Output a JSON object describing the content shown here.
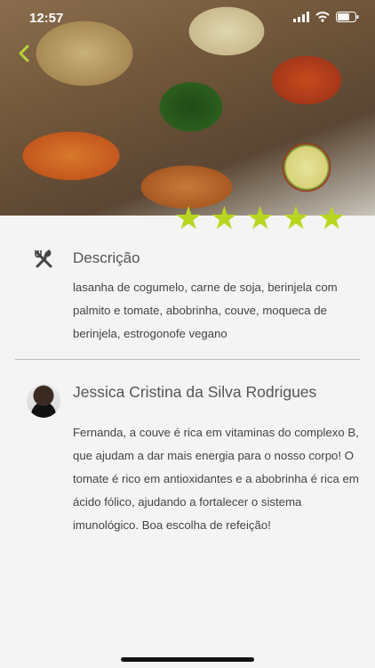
{
  "status_bar": {
    "time": "12:57"
  },
  "rating": {
    "value": 5,
    "max": 5,
    "color": "#b7d620"
  },
  "description": {
    "title": "Descrição",
    "text": "lasanha de cogumelo, carne de soja, berinjela com palmito e tomate, abobrinha, couve, moqueca de berinjela, estrogonofe vegano"
  },
  "comment": {
    "author": "Jessica Cristina da Silva Rodrigues",
    "text": "Fernanda, a couve é rica em vitaminas do complexo B, que ajudam a dar mais energia para o nosso corpo! O tomate é rico em antioxidantes e a abobrinha é rica em ácido fólico, ajudando a fortalecer o sistema imunológico. Boa escolha de refeição!"
  },
  "colors": {
    "accent": "#b7d620",
    "back_arrow": "#b7d33a",
    "text": "#444444"
  },
  "icons": [
    "back-icon",
    "cutlery-icon",
    "signal-icon",
    "wifi-icon",
    "battery-icon",
    "star-icon"
  ]
}
